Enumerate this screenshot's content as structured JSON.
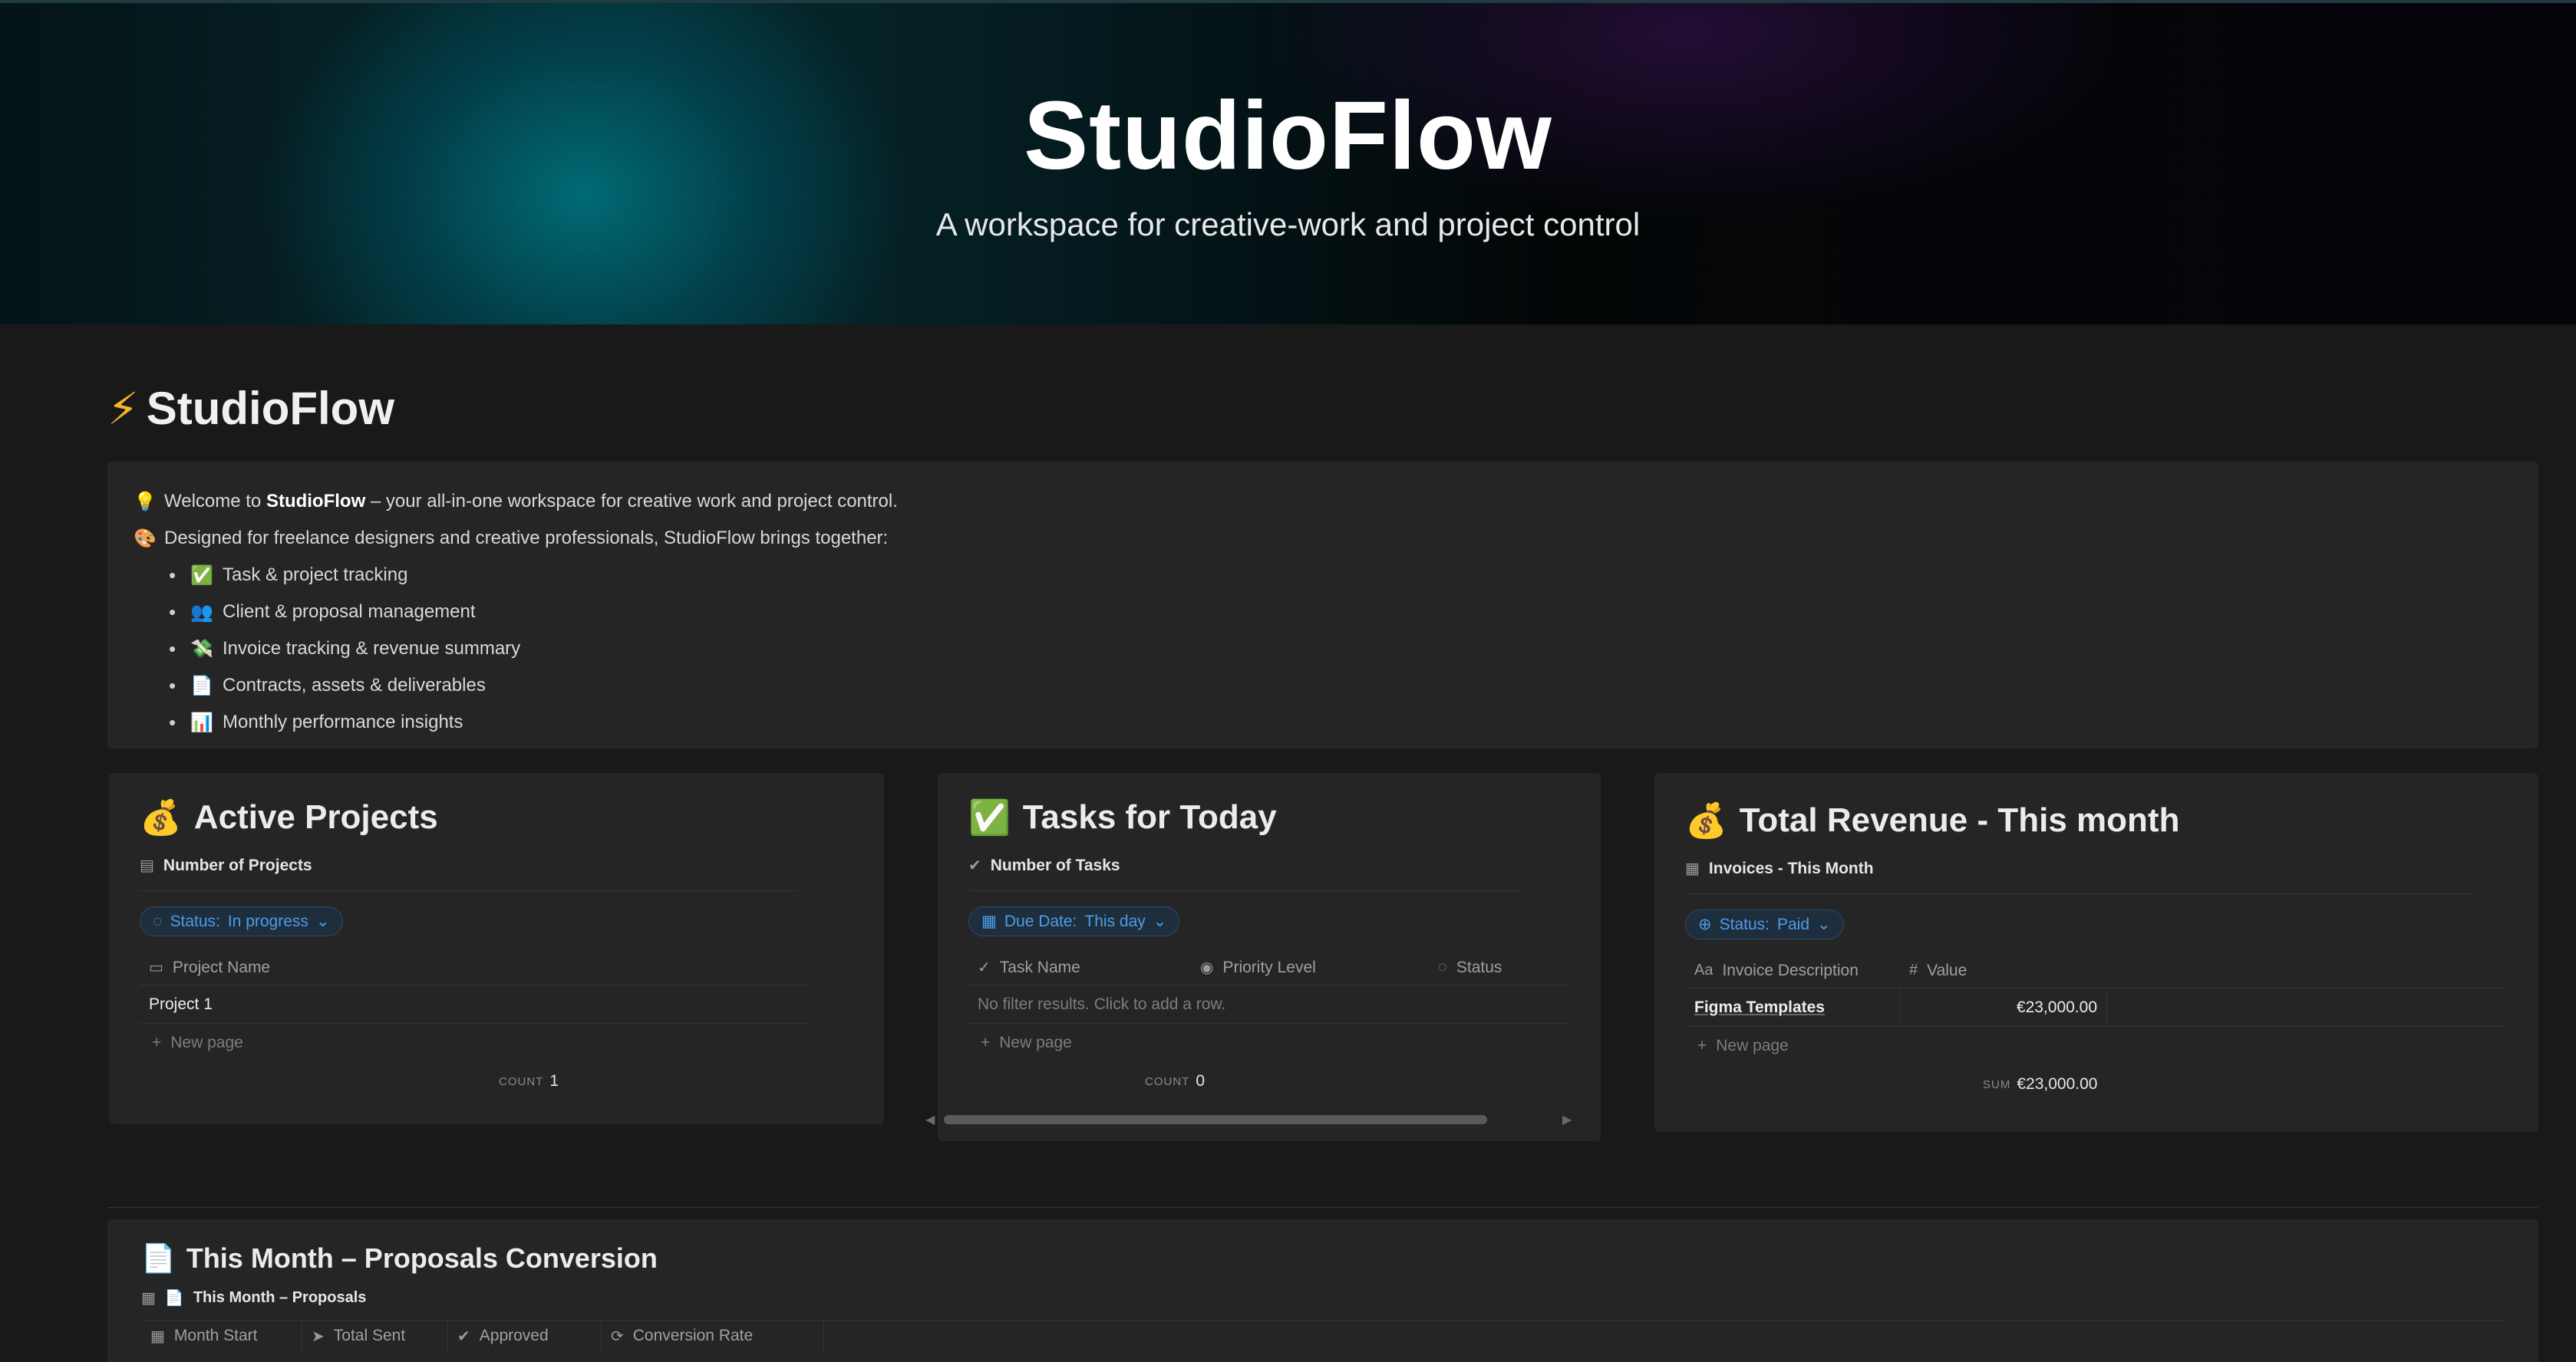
{
  "banner": {
    "title": "StudioFlow",
    "subtitle": "A workspace for creative-work and project control"
  },
  "page": {
    "title": "StudioFlow",
    "title_icon": "lightning-icon"
  },
  "callout": {
    "welcome_prefix": "Welcome to ",
    "welcome_brand": "StudioFlow",
    "welcome_suffix": " – your all-in-one workspace for creative work and project control.",
    "designed": "Designed for freelance designers and creative professionals, StudioFlow brings together:",
    "bullets": [
      "Task & project tracking",
      "Client & proposal management",
      "Invoice tracking & revenue summary",
      "Contracts, assets & deliverables",
      "Monthly performance insights"
    ]
  },
  "active_projects": {
    "title": "Active Projects",
    "db_name": "Number of Projects",
    "filter_label": "Status:",
    "filter_value": "In progress",
    "columns": [
      "Project Name"
    ],
    "rows": [
      "Project 1"
    ],
    "new_page": "New page",
    "count_label": "COUNT",
    "count_value": "1"
  },
  "tasks_today": {
    "title": "Tasks for Today",
    "db_name": "Number of Tasks",
    "filter_label": "Due Date:",
    "filter_value": "This day",
    "columns": [
      "Task Name",
      "Priority Level",
      "Status"
    ],
    "empty_text": "No filter results. Click to add a row.",
    "new_page": "New page",
    "count_label": "COUNT",
    "count_value": "0"
  },
  "revenue": {
    "title": "Total Revenue - This month",
    "db_name": "Invoices - This Month",
    "filter_label": "Status:",
    "filter_value": "Paid",
    "columns": [
      "Invoice Description",
      "Value"
    ],
    "row_name": "Figma Templates",
    "row_value": "€23,000.00",
    "new_page": "New page",
    "sum_label": "SUM",
    "sum_value": "€23,000.00"
  },
  "proposals": {
    "title": "This Month – Proposals Conversion",
    "db_name": "This Month – Proposals",
    "columns": [
      "Month Start",
      "Total Sent",
      "Approved",
      "Conversion Rate"
    ]
  },
  "colors": {
    "background": "#191919",
    "card": "#252525",
    "accent_blue": "#4b9de8",
    "bolt": "#f5b32a"
  }
}
